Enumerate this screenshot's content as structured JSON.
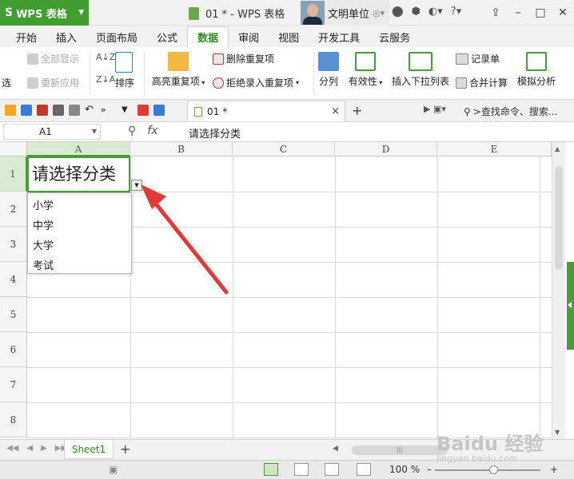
{
  "titlebar": {
    "app_name": "WPS 表格",
    "doc_title": "01 * - WPS 表格",
    "user_name": "文明单位"
  },
  "tabs": [
    {
      "label": "开始"
    },
    {
      "label": "插入"
    },
    {
      "label": "页面布局"
    },
    {
      "label": "公式"
    },
    {
      "label": "数据",
      "active": true
    },
    {
      "label": "审阅"
    },
    {
      "label": "视图"
    },
    {
      "label": "开发工具"
    },
    {
      "label": "云服务"
    }
  ],
  "ribbon": {
    "select_label": "选",
    "show_all": "全部显示",
    "reapply": "重新应用",
    "sort": "排序",
    "highlight_dup": "高亮重复项",
    "remove_dup": "删除重复项",
    "reject_dup": "拒绝录入重复项",
    "split": "分列",
    "validity": "有效性",
    "insert_dropdown": "插入下拉列表",
    "record_form": "记录单",
    "merge_calc": "合并计算",
    "simulate": "模拟分析"
  },
  "qab": {
    "file_tab": "01 *",
    "search": ">查找命令、搜索..."
  },
  "formula_bar": {
    "cell_ref": "A1",
    "fx": "fx",
    "content": "请选择分类"
  },
  "grid": {
    "columns": [
      "A",
      "B",
      "C",
      "D",
      "E"
    ],
    "rows": [
      "1",
      "2",
      "3",
      "4",
      "5",
      "6",
      "7",
      "8"
    ],
    "active_cell_value": "请选择分类"
  },
  "dropdown": {
    "options": [
      "小学",
      "中学",
      "大学",
      "考试"
    ]
  },
  "sheets": {
    "active": "Sheet1"
  },
  "status": {
    "zoom": "100 %"
  },
  "watermark": {
    "brand": "Baidu 经验",
    "url": "jingyan.baidu.com"
  },
  "colors": {
    "accent": "#3f9e2f",
    "arrow": "#e53935"
  }
}
